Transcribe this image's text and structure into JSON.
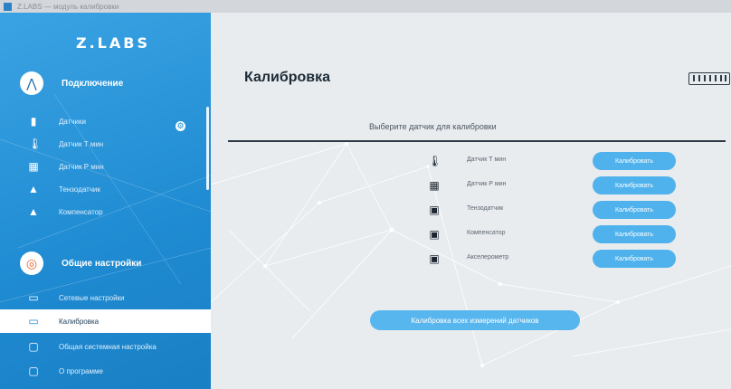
{
  "window": {
    "title": "Z.LABS — модуль калибровки"
  },
  "sidebar": {
    "brand": "Z.LABS",
    "section1": {
      "label": "Подключение",
      "icon": "arrow-up-icon"
    },
    "items_top": [
      {
        "label": "Датчики",
        "icon": "sensor-icon"
      },
      {
        "label": "Датчик Т мин",
        "icon": "thermometer-icon"
      },
      {
        "label": "Датчик Р мин",
        "icon": "grid-icon"
      },
      {
        "label": "Тензодатчик",
        "icon": "image-icon"
      },
      {
        "label": "Компенсатор",
        "icon": "image-icon"
      }
    ],
    "section2": {
      "label": "Общие настройки",
      "icon": "lifebuoy-icon"
    },
    "items_bottom": [
      {
        "label": "Сетевые настройки",
        "icon": "network-icon"
      },
      {
        "label": "Калибровка",
        "icon": "keyboard-icon"
      },
      {
        "label": "Общая системная настройка",
        "icon": "settings-icon"
      },
      {
        "label": "О программе",
        "icon": "info-icon"
      }
    ],
    "active_index": 1
  },
  "main": {
    "title": "Калибровка",
    "subtitle": "Выберите датчик для калибровки",
    "sensors": [
      {
        "name": "Датчик Т мин",
        "icon": "thermometer-icon",
        "button": "Калибровать"
      },
      {
        "name": "Датчик Р мин",
        "icon": "grid-icon",
        "button": "Калибровать"
      },
      {
        "name": "Тензодатчик",
        "icon": "image-icon",
        "button": "Калибровать"
      },
      {
        "name": "Компенсатор",
        "icon": "image-icon",
        "button": "Калибровать"
      },
      {
        "name": "Акселерометр",
        "icon": "image-icon",
        "button": "Калибровать"
      }
    ],
    "bottom_button": "Калибровка всех измерений датчиков"
  },
  "colors": {
    "accent": "#1f8bd2",
    "button": "#4fb2ec"
  }
}
